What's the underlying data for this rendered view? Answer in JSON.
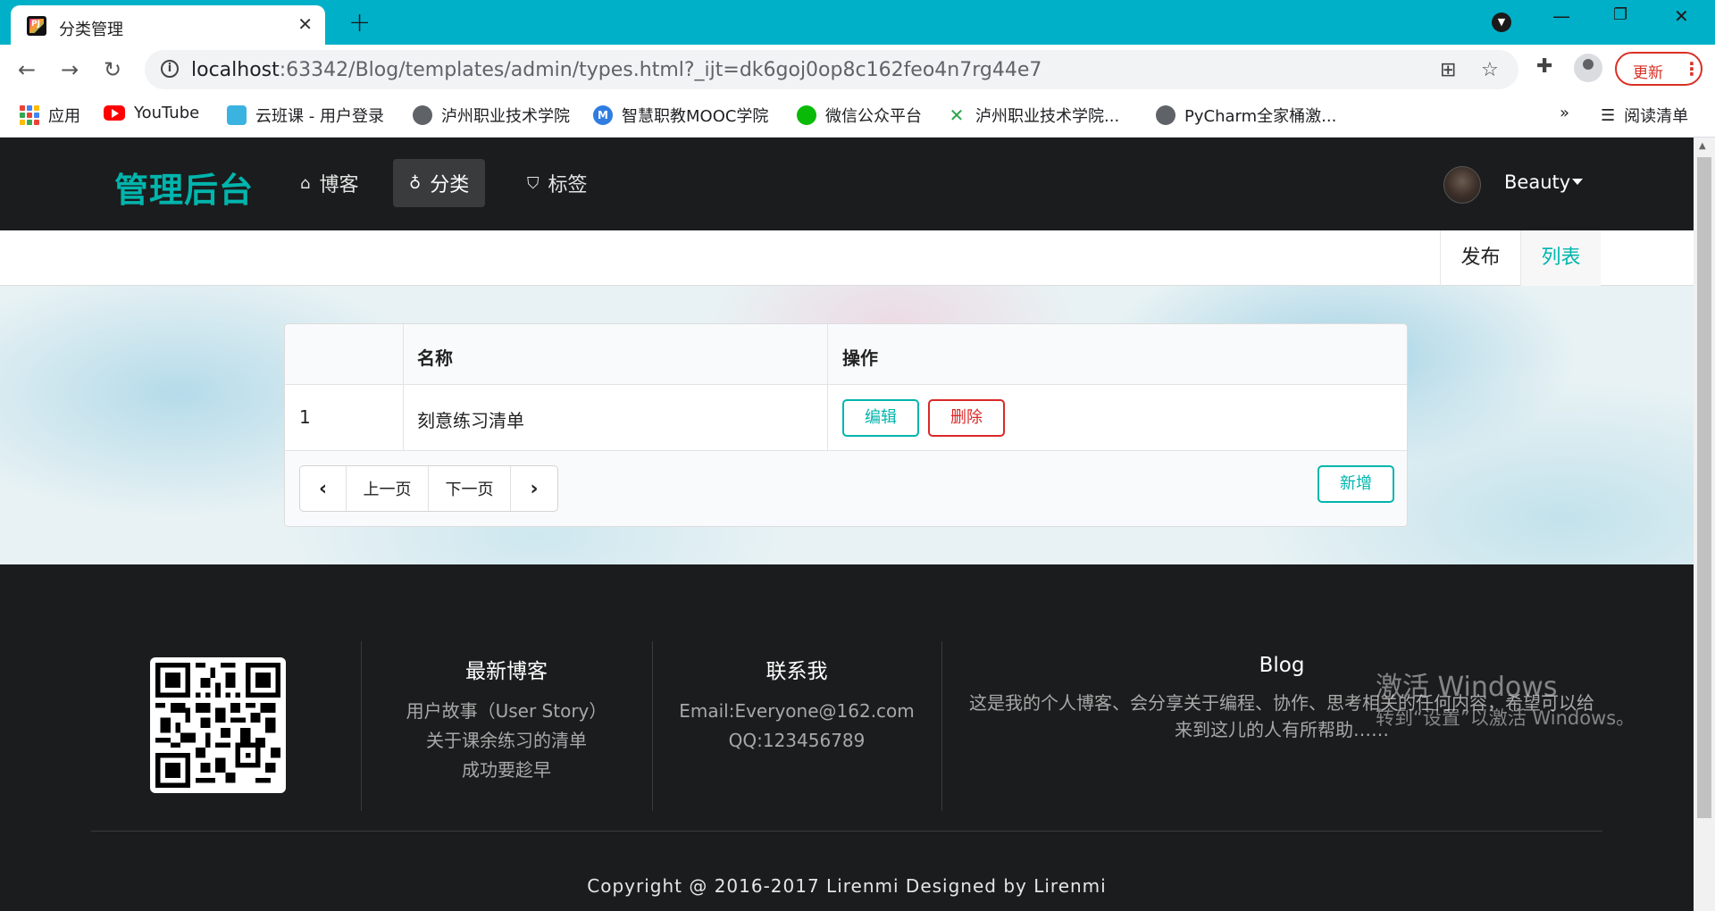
{
  "browser": {
    "tab_title": "分类管理",
    "tab_close": "✕",
    "new_tab": "+",
    "url_host": "localhost",
    "url_rest": ":63342/Blog/templates/admin/types.html?_ijt=dk6goj0op8c162feo4n7rg44e7",
    "update_label": "更新",
    "bookmarks": [
      "应用",
      "YouTube",
      "云班课 - 用户登录",
      "泸州职业技术学院",
      "智慧职教MOOC学院",
      "微信公众平台",
      "泸州职业技术学院...",
      "PyCharm全家桶激..."
    ],
    "more_bookmarks": "»",
    "reading_list": "阅读清单"
  },
  "nav": {
    "brand": "管理后台",
    "items": [
      {
        "icon": "home-icon",
        "label": "博客"
      },
      {
        "icon": "lightbulb-icon",
        "label": "分类"
      },
      {
        "icon": "tags-icon",
        "label": "标签"
      }
    ],
    "active_index": 1,
    "user_name": "Beauty"
  },
  "subnav": {
    "publish": "发布",
    "list": "列表",
    "active": "列表"
  },
  "table": {
    "headers": [
      "",
      "名称",
      "操作"
    ],
    "rows": [
      {
        "id": "1",
        "name": "刻意练习清单"
      }
    ],
    "edit_label": "编辑",
    "delete_label": "删除",
    "prev_label": "上一页",
    "next_label": "下一页",
    "add_label": "新增"
  },
  "footer": {
    "latest_title": "最新博客",
    "latest_items": [
      "用户故事（User Story）",
      "关于课余练习的清单",
      "成功要趁早"
    ],
    "contact_title": "联系我",
    "contact_items": [
      "Email:Everyone@162.com",
      "QQ:123456789"
    ],
    "blog_title": "Blog",
    "blog_text": "这是我的个人博客、会分享关于编程、协作、思考相关的任何内容，希望可以给来到这儿的人有所帮助……",
    "copyright": "Copyright @ 2016-2017 Lirenmi Designed by Lirenmi"
  },
  "watermark": {
    "line1": "激活 Windows",
    "line2": "转到“设置”以激活 Windows。"
  },
  "colors": {
    "tabbar": "#00b0c8",
    "accent": "#00b5ad",
    "danger": "#db2828",
    "dark": "#1b1c1d"
  }
}
